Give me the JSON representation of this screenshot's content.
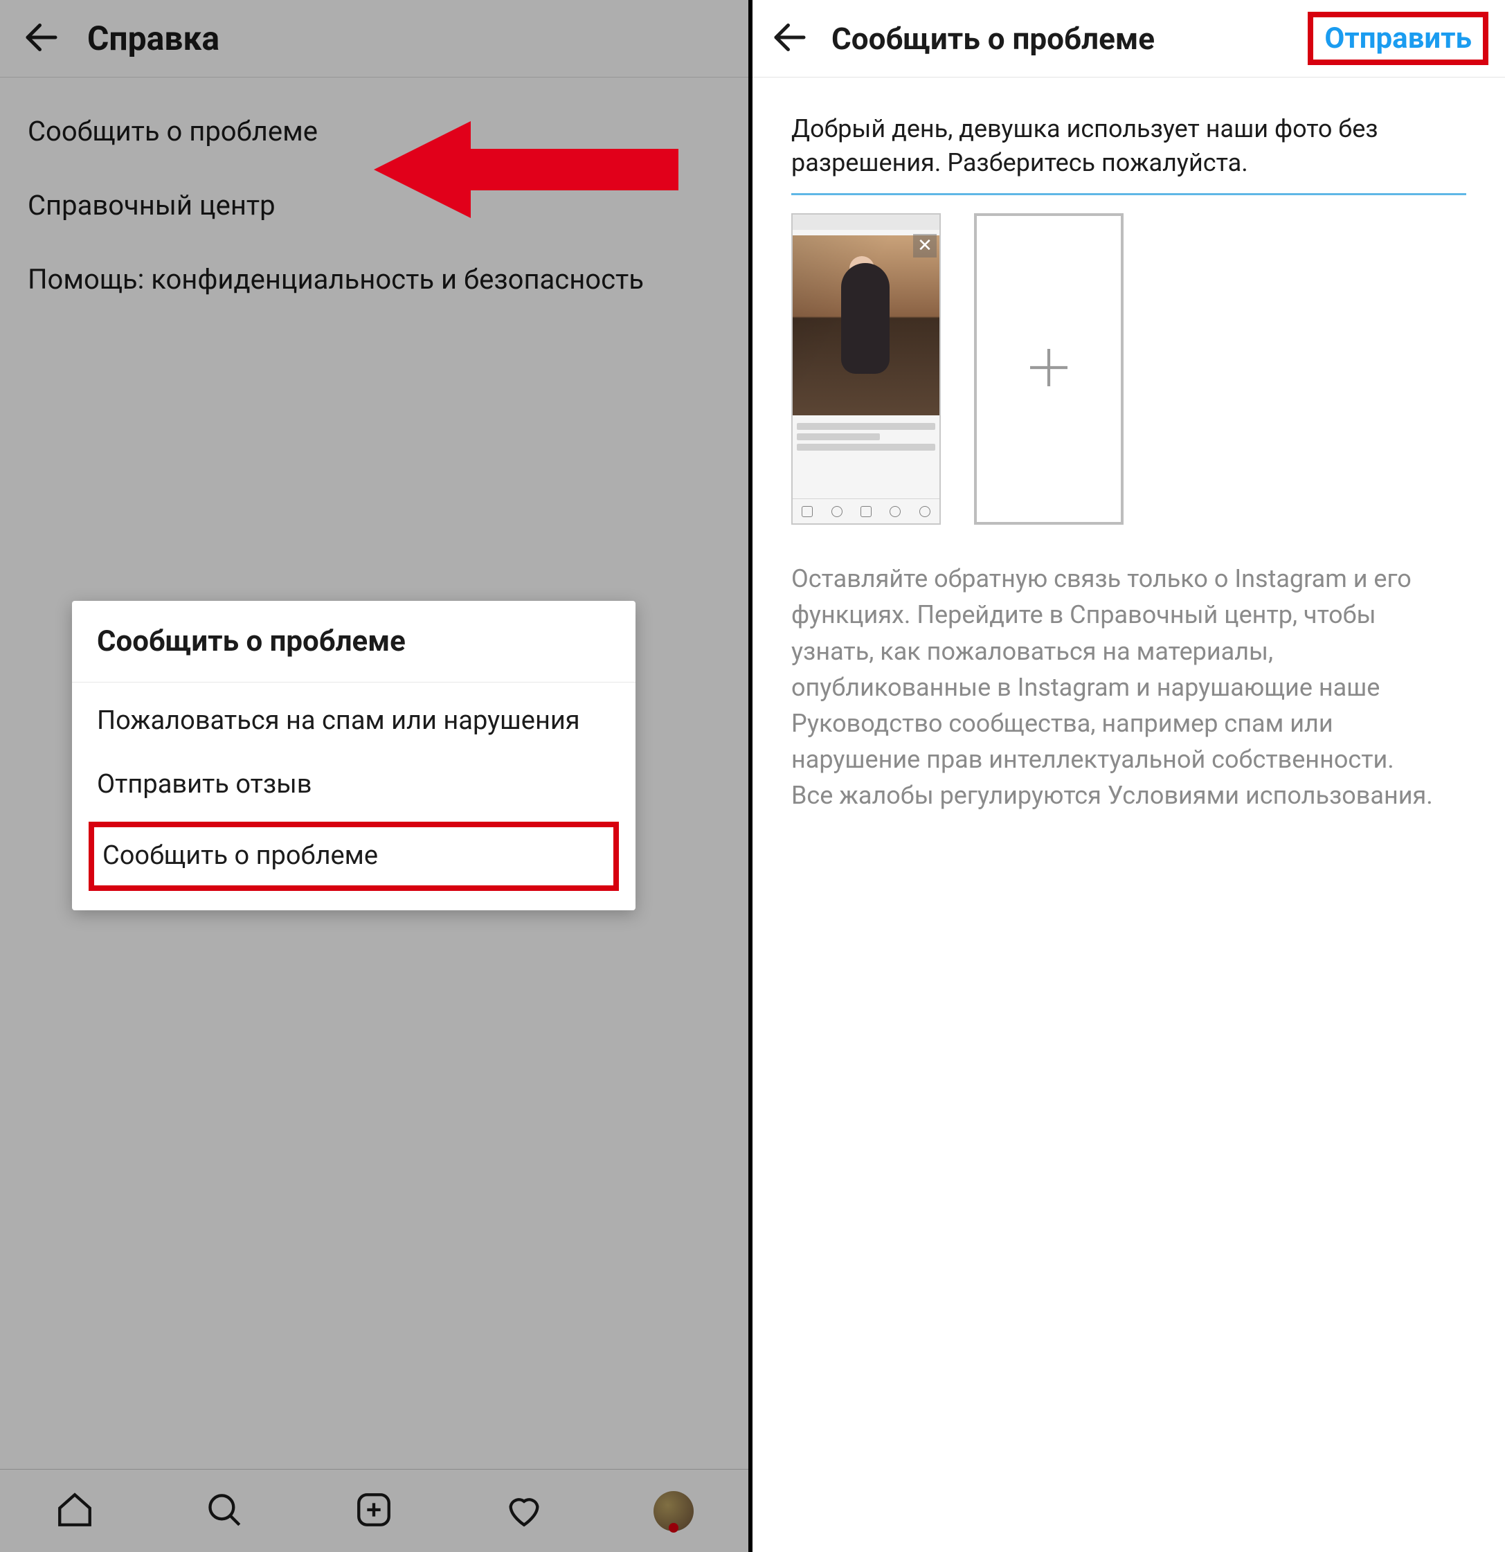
{
  "left": {
    "header_title": "Справка",
    "menu": {
      "report_problem": "Сообщить  о проблеме",
      "help_center": "Справочный центр",
      "privacy_security": "Помощь: конфиденциальность и безопасность"
    },
    "dialog": {
      "title": "Сообщить  о проблеме",
      "item_spam": "Пожаловаться на спам или нарушения",
      "item_feedback": "Отправить отзыв",
      "item_report": "Сообщить о проблеме"
    }
  },
  "right": {
    "header_title": "Сообщить о проблеме",
    "submit_label": "Отправить",
    "report_text": "Добрый день, девушка использует наши фото без разрешения. Разберитесь пожалуйста.",
    "hint": "Оставляйте обратную связь только о Instagram и его функциях. Перейдите в Справочный центр, чтобы узнать, как пожаловаться на материалы, опубликованные в Instagram и нарушающие наше Руководство сообщества, например спам или нарушение прав интеллектуальной собственности. Все жалобы регулируются Условиями использования."
  }
}
